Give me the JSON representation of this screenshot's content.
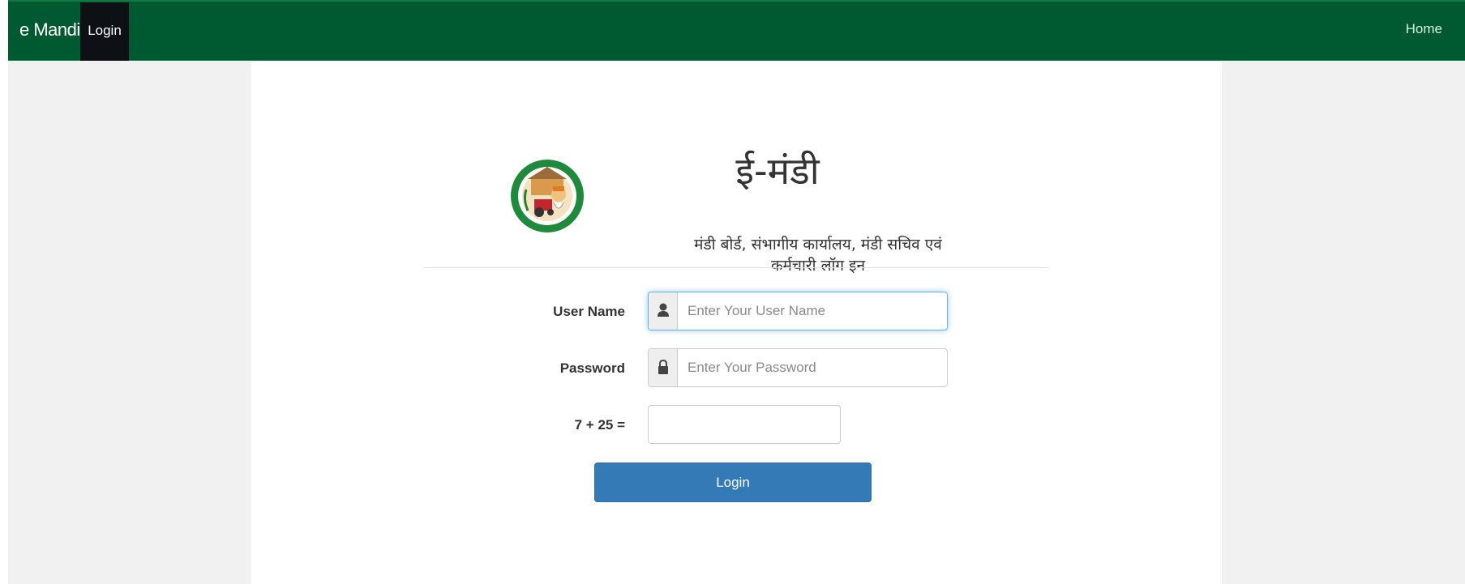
{
  "navbar": {
    "brand": "e Mandi",
    "login_tab": "Login",
    "home_link": "Home",
    "color": "#005a31"
  },
  "header": {
    "title": "ई-मंडी",
    "subtitle": "मंडी बोर्ड, संभागीय कार्यालय, मंडी सचिव एवं कर्मचारी लॉग इन",
    "logo_icon": "mandi-board-emblem"
  },
  "form": {
    "username": {
      "label": "User Name",
      "placeholder": "Enter Your User Name",
      "value": "",
      "icon": "user-icon"
    },
    "password": {
      "label": "Password",
      "placeholder": "Enter Your Password",
      "value": "",
      "icon": "lock-icon"
    },
    "captcha": {
      "label": "7 + 25 =",
      "value": ""
    },
    "submit_label": "Login",
    "submit_color": "#337ab7"
  }
}
